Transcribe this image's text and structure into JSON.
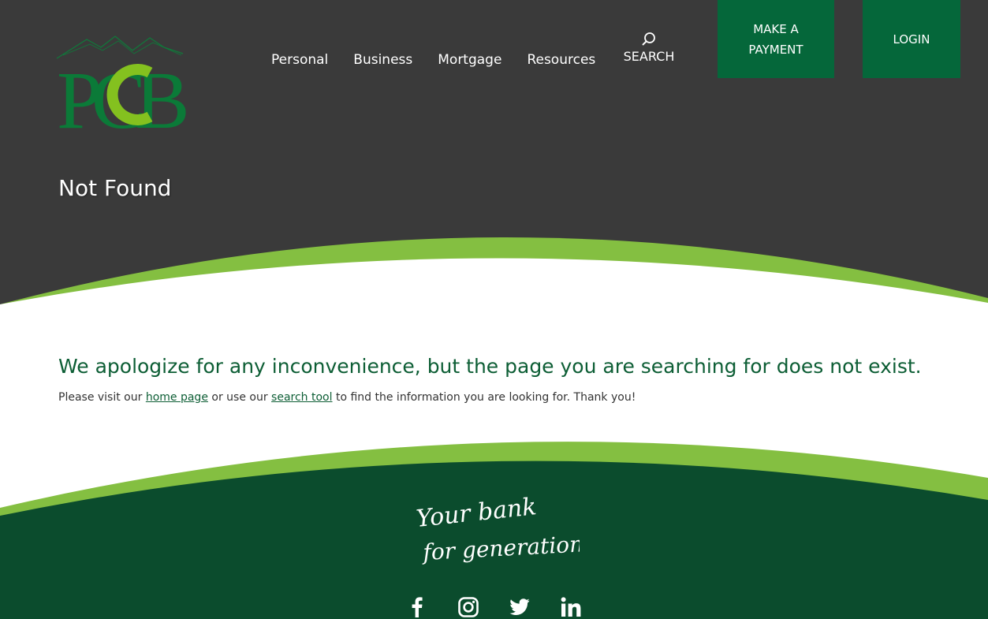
{
  "brand": {
    "logo_text": "PCB",
    "colors": {
      "header_bg": "#3a3a3a",
      "dark_green": "#05673a",
      "light_green": "#84bf41",
      "footer_green": "#0b4c2d",
      "heading_green": "#0d5e35"
    }
  },
  "nav": {
    "items": [
      {
        "label": "Personal"
      },
      {
        "label": "Business"
      },
      {
        "label": "Mortgage"
      },
      {
        "label": "Resources"
      }
    ],
    "search_label": "SEARCH",
    "search_icon": "search-icon"
  },
  "buttons": {
    "payment_line1": "MAKE A",
    "payment_line2": "PAYMENT",
    "login_label": "LOGIN"
  },
  "page": {
    "title": "Not Found",
    "apology": "We apologize for any inconvenience, but the page you are searching for does not exist.",
    "info_part1": "Please visit our ",
    "home_link": "home page",
    "info_part2": " or use our ",
    "search_link": "search tool",
    "info_part3": " to find the information you are looking for. Thank you!"
  },
  "footer": {
    "tagline_line1": "Your bank",
    "tagline_line2": "for generations...",
    "social": [
      {
        "name": "facebook-icon"
      },
      {
        "name": "instagram-icon"
      },
      {
        "name": "twitter-icon"
      },
      {
        "name": "linkedin-icon"
      }
    ]
  }
}
